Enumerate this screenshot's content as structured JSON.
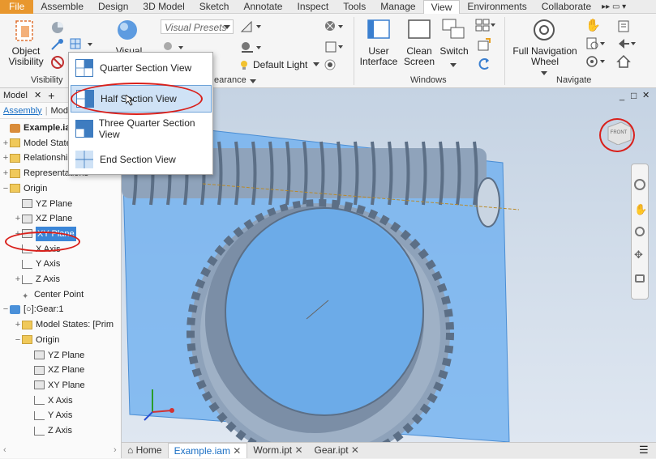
{
  "menu": {
    "tabs": [
      "File",
      "Assemble",
      "Design",
      "3D Model",
      "Sketch",
      "Annotate",
      "Inspect",
      "Tools",
      "Manage",
      "View",
      "Environments",
      "Collaborate"
    ],
    "active_tab": "View",
    "more_label": "▸▸ ▭ ▾"
  },
  "ribbon": {
    "object_visibility": "Object\nVisibility",
    "visual_style": "Visual Style",
    "visual_presets": "Visual Presets",
    "default_light": "Default Light",
    "appearance_label": "earance",
    "user_interface": "User\nInterface",
    "clean_screen": "Clean\nScreen",
    "switch": "Switch",
    "full_navigation_wheel": "Full Navigation\nWheel",
    "panels": {
      "visibility": "Visibility",
      "windows": "Windows",
      "navigate": "Navigate"
    }
  },
  "section_menu": {
    "items": [
      "Quarter Section View",
      "Half Section View",
      "Three Quarter Section View",
      "End Section View"
    ],
    "highlighted_index": 1
  },
  "browser": {
    "tab_label": "Model",
    "assembly_tab": "Assembly",
    "modeling_tab": "Mod",
    "tree": [
      {
        "label": "Example.iam",
        "depth": 0,
        "toggle": "",
        "icon": "asm",
        "bold": true
      },
      {
        "label": "Model States",
        "depth": 0,
        "toggle": "+",
        "icon": "folder"
      },
      {
        "label": "Relationships",
        "depth": 0,
        "toggle": "+",
        "icon": "folder"
      },
      {
        "label": "Representations",
        "depth": 0,
        "toggle": "+",
        "icon": "folder"
      },
      {
        "label": "Origin",
        "depth": 0,
        "toggle": "−",
        "icon": "folder"
      },
      {
        "label": "YZ Plane",
        "depth": 1,
        "toggle": "",
        "icon": "plane"
      },
      {
        "label": "XZ Plane",
        "depth": 1,
        "toggle": "+",
        "icon": "plane"
      },
      {
        "label": "XY Plane",
        "depth": 1,
        "toggle": "+",
        "icon": "plane",
        "selected": true
      },
      {
        "label": "X Axis",
        "depth": 1,
        "toggle": "",
        "icon": "axis"
      },
      {
        "label": "Y Axis",
        "depth": 1,
        "toggle": "",
        "icon": "axis"
      },
      {
        "label": "Z Axis",
        "depth": 1,
        "toggle": "+",
        "icon": "axis"
      },
      {
        "label": "Center Point",
        "depth": 1,
        "toggle": "",
        "icon": "point"
      },
      {
        "label": "[○]:Gear:1",
        "depth": 0,
        "toggle": "−",
        "icon": "part"
      },
      {
        "label": "Model States: [Prim",
        "depth": 1,
        "toggle": "+",
        "icon": "folder"
      },
      {
        "label": "Origin",
        "depth": 1,
        "toggle": "−",
        "icon": "folder"
      },
      {
        "label": "YZ Plane",
        "depth": 2,
        "toggle": "",
        "icon": "plane"
      },
      {
        "label": "XZ Plane",
        "depth": 2,
        "toggle": "",
        "icon": "plane"
      },
      {
        "label": "XY Plane",
        "depth": 2,
        "toggle": "",
        "icon": "plane"
      },
      {
        "label": "X Axis",
        "depth": 2,
        "toggle": "",
        "icon": "axis"
      },
      {
        "label": "Y Axis",
        "depth": 2,
        "toggle": "",
        "icon": "axis"
      },
      {
        "label": "Z Axis",
        "depth": 2,
        "toggle": "",
        "icon": "axis"
      }
    ]
  },
  "viewcube_label": "FRONT",
  "doc_tabs": [
    {
      "label": "Home",
      "active": false,
      "closable": false
    },
    {
      "label": "Example.iam",
      "active": true,
      "closable": true
    },
    {
      "label": "Worm.ipt",
      "active": false,
      "closable": true
    },
    {
      "label": "Gear.ipt",
      "active": false,
      "closable": true
    }
  ],
  "colors": {
    "file_tab": "#e8972e",
    "highlight": "#cfe2f6",
    "annotation_red": "#d9201b",
    "section_plane": "#5aa0e8"
  }
}
